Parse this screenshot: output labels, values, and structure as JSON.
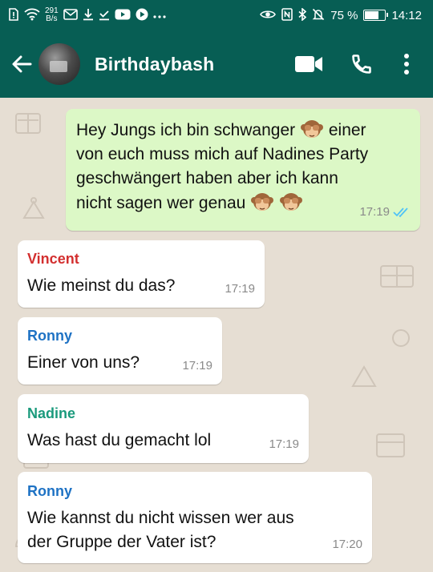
{
  "status_bar": {
    "net_speed": "291",
    "net_unit": "B/s",
    "battery_text": "75 %",
    "battery_level": 0.75,
    "time": "14:12"
  },
  "header": {
    "title": "Birthdaybash",
    "icons": [
      "arrow-left-icon",
      "group-avatar",
      "video-call-icon",
      "phone-icon",
      "more-vert-icon"
    ]
  },
  "messages": [
    {
      "direction": "out",
      "lines": [
        "Hey Jungs ich bin schwanger",
        "einer",
        "von euch muss mich auf Nadines Party",
        "geschwängert haben aber ich kann",
        "nicht sagen wer genau"
      ],
      "emoji": "see-no-evil-monkey",
      "time": "17:19",
      "status": "read"
    },
    {
      "direction": "in",
      "sender": "Vincent",
      "sender_color": "#d32f2f",
      "lines": [
        "Wie meinst du das?"
      ],
      "time": "17:19"
    },
    {
      "direction": "in",
      "sender": "Ronny",
      "sender_color": "#1e72c4",
      "lines": [
        "Einer von uns?"
      ],
      "time": "17:19"
    },
    {
      "direction": "in",
      "sender": "Nadine",
      "sender_color": "#1a9a7c",
      "lines": [
        "Was hast du gemacht lol"
      ],
      "time": "17:19"
    },
    {
      "direction": "in",
      "sender": "Ronny",
      "sender_color": "#1e72c4",
      "lines": [
        "Wie kannst du nicht wissen wer aus",
        "der Gruppe der Vater ist?"
      ],
      "time": "17:20"
    }
  ],
  "colors": {
    "toolbar": "#075e54",
    "outgoing_bubble": "#dcf8c6",
    "incoming_bubble": "#ffffff",
    "wallpaper": "#e6ded3",
    "read_ticks": "#4fc3f7"
  }
}
